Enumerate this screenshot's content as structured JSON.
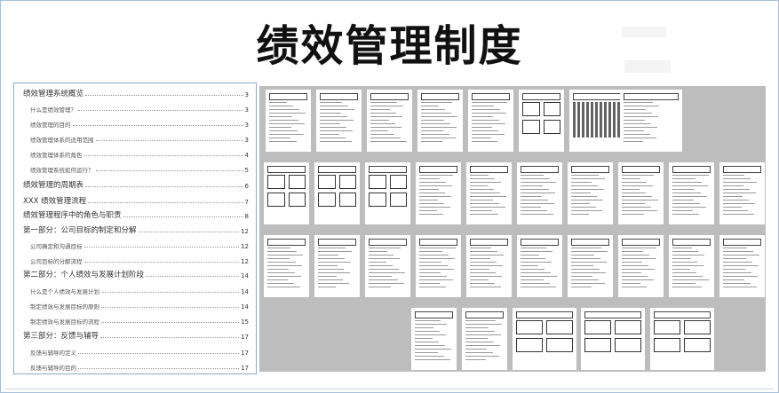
{
  "title": "绩效管理制度",
  "toc": [
    {
      "label": "绩效管理系统概览",
      "page": "3",
      "level": 1
    },
    {
      "label": "什么是绩效管理？",
      "page": "3",
      "level": 2
    },
    {
      "label": "绩效管理的目的",
      "page": "3",
      "level": 2
    },
    {
      "label": "绩效管理体系的适用范围",
      "page": "3",
      "level": 2
    },
    {
      "label": "绩效管理体系的角色",
      "page": "4",
      "level": 2
    },
    {
      "label": "绩效管理系统如何运行？",
      "page": "5",
      "level": 2
    },
    {
      "label": "绩效管理的周期表",
      "page": "6",
      "level": 1
    },
    {
      "label": "XXX 绩效管理流程",
      "page": "7",
      "level": 1
    },
    {
      "label": "绩效管理程序中的角色与职责",
      "page": "8",
      "level": 1
    },
    {
      "label": "第一部分：公司目标的制定和分解",
      "page": "12",
      "level": 1
    },
    {
      "label": "公司确定和沟通目标",
      "page": "12",
      "level": 2
    },
    {
      "label": "公司目标的分解流程",
      "page": "12",
      "level": 2
    },
    {
      "label": "第二部分：个人绩效与发展计划阶段",
      "page": "14",
      "level": 1
    },
    {
      "label": "什么是个人绩效与发展计划",
      "page": "14",
      "level": 2
    },
    {
      "label": "制定绩效与发展目标的原则",
      "page": "14",
      "level": 2
    },
    {
      "label": "制定绩效与发展目标的流程",
      "page": "15",
      "level": 2
    },
    {
      "label": "第三部分：反馈与辅导",
      "page": "17",
      "level": 1
    },
    {
      "label": "反馈与辅导的定义",
      "page": "17",
      "level": 2
    },
    {
      "label": "反馈与辅导的目的",
      "page": "17",
      "level": 2
    }
  ]
}
